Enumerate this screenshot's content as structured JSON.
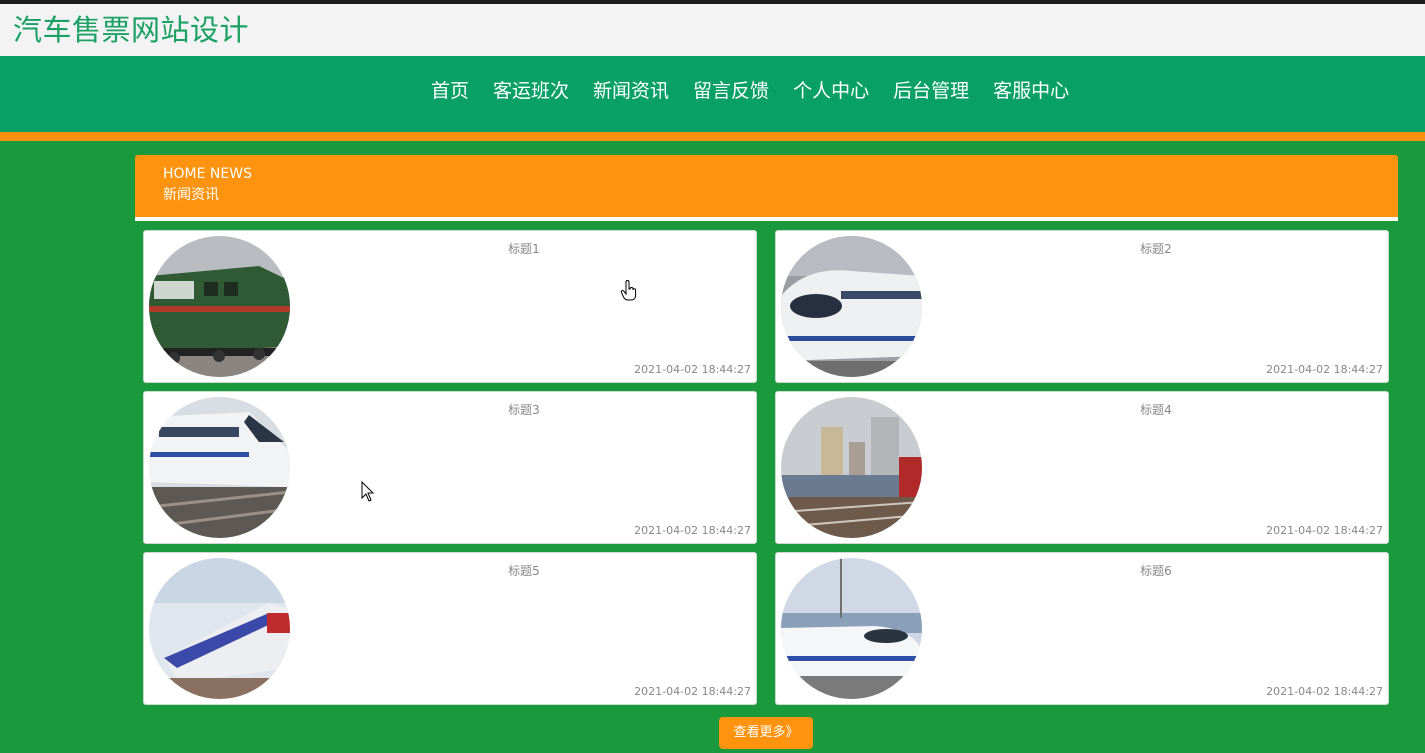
{
  "site": {
    "title": "汽车售票网站设计"
  },
  "nav": [
    {
      "label": "首页"
    },
    {
      "label": "客运班次"
    },
    {
      "label": "新闻资讯"
    },
    {
      "label": "留言反馈"
    },
    {
      "label": "个人中心"
    },
    {
      "label": "后台管理"
    },
    {
      "label": "客服中心"
    }
  ],
  "news": {
    "heading_en": "HOME NEWS",
    "heading_zh": "新闻资讯",
    "items": [
      {
        "title": "标题1",
        "time": "2021-04-02 18:44:27",
        "image": "green-locomotive-photo"
      },
      {
        "title": "标题2",
        "time": "2021-04-02 18:44:27",
        "image": "white-bullet-train-photo"
      },
      {
        "title": "标题3",
        "time": "2021-04-02 18:44:27",
        "image": "white-emu-train-photo"
      },
      {
        "title": "标题4",
        "time": "2021-04-02 18:44:27",
        "image": "city-train-tracks-photo"
      },
      {
        "title": "标题5",
        "time": "2021-04-02 18:44:27",
        "image": "blue-red-train-photo"
      },
      {
        "title": "标题6",
        "time": "2021-04-02 18:44:27",
        "image": "crh-bullet-train-photo"
      }
    ],
    "more_label": "查看更多》"
  }
}
